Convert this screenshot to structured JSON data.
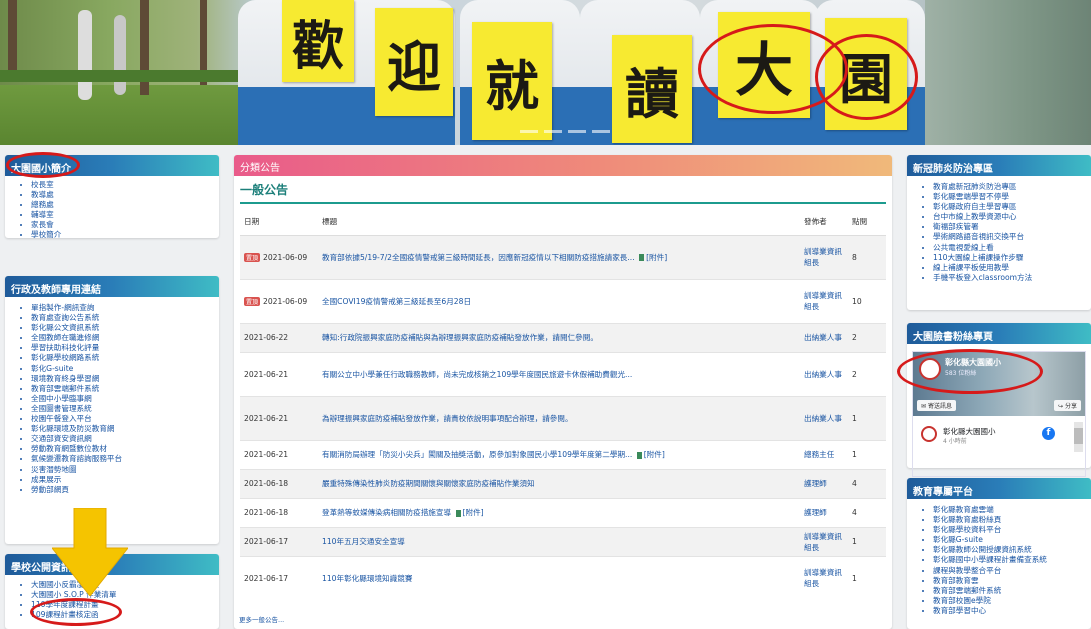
{
  "banner": {
    "signs": [
      "歡",
      "迎",
      "就",
      "讀",
      "大",
      "園"
    ]
  },
  "left_intro": {
    "title": "大園國小簡介",
    "items": [
      "校長室",
      "教導處",
      "總務處",
      "輔導室",
      "家長會",
      "學校簡介"
    ]
  },
  "left_admin": {
    "title": "行政及教師專用連結",
    "items": [
      "單指製作-網訊查詢",
      "教育處查詢公告系統",
      "彰化縣公文資訊系統",
      "全國教師在職進修網",
      "學習扶助科技化評量",
      "彰化縣學校網路系統",
      "彰化G-suite",
      "環境教育終身學習網",
      "教育部雲端郵件系統",
      "全國中小學臨事網",
      "全國圖書管理系統",
      "校園午餐登入平台",
      "彰化縣環境及防災教育網",
      "交通部資安資訊網",
      "勞動教育網暨數位教材",
      "氣候變遷教育諮詢服務平台",
      "災害潛勢地圖",
      "成果展示",
      "勞動部網頁"
    ]
  },
  "left_public": {
    "title": "學校公開資訊",
    "items": [
      "大園國小反霸凌專區",
      "大園國小 S.O.P 作業清單",
      "110學年度課程計畫",
      "109課程計畫核定函"
    ]
  },
  "center": {
    "header": "分類公告",
    "subtitle": "一般公告",
    "columns": [
      "日期",
      "標題",
      "發佈者",
      "點閱"
    ],
    "rows": [
      {
        "hot": "置頂",
        "date": "2021-06-09",
        "title": "教育部依據5/19-7/2全國疫情警戒第三級時間延長，因應新冠疫情以下相關防疫措施請家長...",
        "attach": "[附件]",
        "publisher": "訓導業資訊組長",
        "clicks": "8"
      },
      {
        "hot": "置頂",
        "date": "2021-06-09",
        "title": "全國COVI19疫情警戒第三級延長至6月28日",
        "attach": "",
        "publisher": "訓導業資訊組長",
        "clicks": "10"
      },
      {
        "hot": "",
        "date": "2021-06-22",
        "title": "轉知:行政院振興家庭防疫補貼與為辦理振興家庭防疫補貼發放作業，請閱仁參閱。",
        "attach": "",
        "publisher": "出納業人事",
        "clicks": "2"
      },
      {
        "hot": "",
        "date": "2021-06-21",
        "title": "有關公立中小學兼任行政職務教師，尚未完成核銷之109學年度國民旅遊卡休假補助費觀光...",
        "attach": "",
        "publisher": "出納業人事",
        "clicks": "2"
      },
      {
        "hot": "",
        "date": "2021-06-21",
        "title": "為辦理振興家庭防疫補貼發放作業，請貴校依說明事項配合辦理，請參閱。",
        "attach": "",
        "publisher": "出納業人事",
        "clicks": "1"
      },
      {
        "hot": "",
        "date": "2021-06-21",
        "title": "有關消防局辦理「防災小尖兵」闖關及抽獎活動，原參加對象國民小學109學年度第二學期...",
        "attach": "[附件]",
        "publisher": "總務主任",
        "clicks": "1"
      },
      {
        "hot": "",
        "date": "2021-06-18",
        "title": "嚴重特殊傳染性肺炎防疫期間關懷與關懷家庭防疫補貼作業須知",
        "attach": "",
        "publisher": "護理師",
        "clicks": "4"
      },
      {
        "hot": "",
        "date": "2021-06-18",
        "title": "登革熱等蚊媒傳染病相關防疫措施宣導",
        "attach": "[附件]",
        "publisher": "護理師",
        "clicks": "4"
      },
      {
        "hot": "",
        "date": "2021-06-17",
        "title": "110年五月交通安全宣導",
        "attach": "",
        "publisher": "訓導業資訊組長",
        "clicks": "1"
      },
      {
        "hot": "",
        "date": "2021-06-17",
        "title": "110年彰化縣環境知識競賽",
        "attach": "",
        "publisher": "訓導業資訊組長",
        "clicks": "1"
      }
    ],
    "more": "更多一般公告..."
  },
  "right_covid": {
    "title": "新冠肺炎防治專區",
    "items": [
      "教育處新冠肺炎防治專區",
      "彰化縣雲端學習不停學",
      "彰化縣政府自主學習專區",
      "台中市線上教學資源中心",
      "衛福部疾管署",
      "學術網路語音視訊交換平台",
      "公共電視愛線上看",
      "110大園線上補課操作步驟",
      "線上補課平板使用教學",
      "手機平板登入classroom方法"
    ]
  },
  "right_fb": {
    "title": "大園臉書粉絲專頁",
    "page_name": "彰化縣大園國小",
    "fans": "583 位粉絲",
    "share_label": "分享",
    "send_label": "寄送訊息",
    "post_name": "彰化縣大園國小",
    "post_time": "4 小時前"
  },
  "right_edu": {
    "title": "教育專屬平台",
    "items": [
      "彰化縣教育處雲端",
      "彰化縣教育處粉絲頁",
      "彰化縣學校資料平台",
      "彰化縣G-suite",
      "彰化縣教師公開授課資訊系統",
      "彰化縣國中小學課程計畫備查系統",
      "課程與教學整合平台",
      "教育部教育雲",
      "教育部雲端郵件系統",
      "教育部校園e學院",
      "教育部學習中心"
    ]
  },
  "colors": {
    "annotation_red": "#d61a1a",
    "arrow_yellow": "#f5c400"
  }
}
